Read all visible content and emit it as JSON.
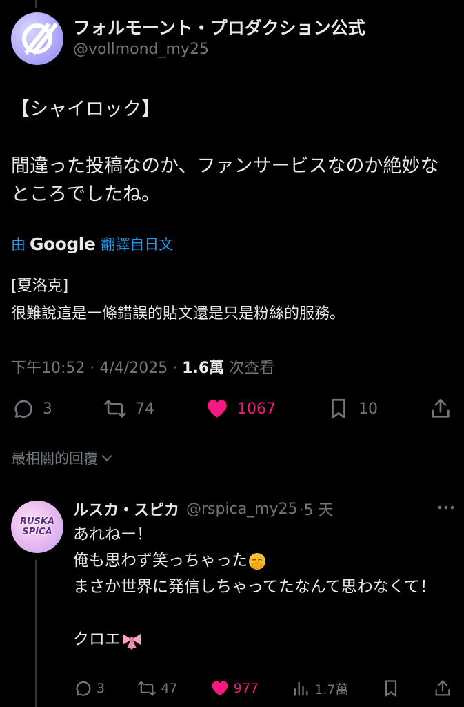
{
  "post": {
    "author_name": "フォルモーント・プロダクション公式",
    "author_handle": "@vollmond_my25",
    "body_line1": "【シャイロック】",
    "body_line2": "間違った投稿なのか、ファンサービスなのか絶妙なところでしたね。",
    "translate_prefix": "由",
    "translate_brand": "Google",
    "translate_suffix": "翻譯自日文",
    "translated_line1": "[夏洛克]",
    "translated_line2": "很難說這是一條錯誤的貼文還是只是粉絲的服務。",
    "timestamp": "下午10:52 · 4/4/2025 · ",
    "views": "1.6萬",
    "views_label": " 次查看",
    "replies": "3",
    "reposts": "74",
    "likes": "1067",
    "bookmarks": "10"
  },
  "replies_filter": {
    "label": "最相關的回覆"
  },
  "reply": {
    "author_name": "ルスカ・スピカ",
    "author_handle": "@rspica_my25",
    "time": "·5 天",
    "avatar_text_1": "RUSKA",
    "avatar_text_2": "SPICA",
    "line1": "あれねー！",
    "line2": "俺も思わず笑っちゃった",
    "line3": "まさか世界に発信しちゃってたなんて思わなくて！",
    "line4": "クロエ",
    "replies": "3",
    "reposts": "47",
    "likes": "977",
    "views": "1.7萬"
  },
  "colors": {
    "background": "#000000",
    "text": "#e7e9ea",
    "secondary": "#71767b",
    "link": "#1d9bf0",
    "like": "#f91880"
  }
}
